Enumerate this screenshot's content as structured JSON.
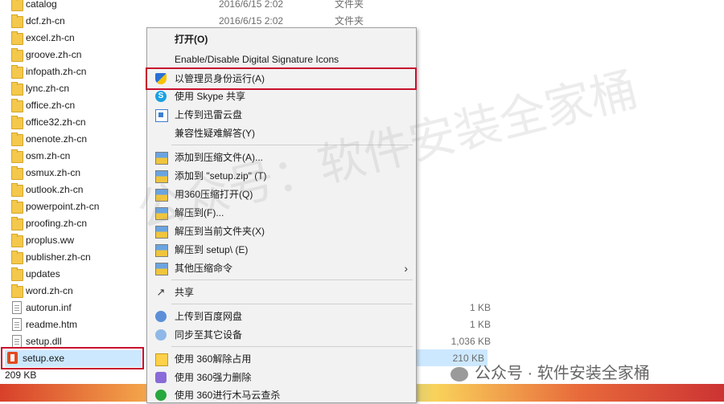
{
  "files": [
    {
      "name": "catalog",
      "date": "2016/6/15 2:02",
      "type": "文件夹",
      "size": "",
      "icon": "folder-icon"
    },
    {
      "name": "dcf.zh-cn",
      "date": "2016/6/15 2:02",
      "type": "文件夹",
      "size": "",
      "icon": "folder-icon"
    },
    {
      "name": "excel.zh-cn",
      "date": "",
      "type": "",
      "size": "",
      "icon": "folder-icon"
    },
    {
      "name": "groove.zh-cn",
      "date": "",
      "type": "",
      "size": "",
      "icon": "folder-icon"
    },
    {
      "name": "infopath.zh-cn",
      "date": "",
      "type": "",
      "size": "",
      "icon": "folder-icon"
    },
    {
      "name": "lync.zh-cn",
      "date": "",
      "type": "",
      "size": "",
      "icon": "folder-icon"
    },
    {
      "name": "office.zh-cn",
      "date": "",
      "type": "",
      "size": "",
      "icon": "folder-icon"
    },
    {
      "name": "office32.zh-cn",
      "date": "",
      "type": "",
      "size": "",
      "icon": "folder-icon"
    },
    {
      "name": "onenote.zh-cn",
      "date": "",
      "type": "",
      "size": "",
      "icon": "folder-icon"
    },
    {
      "name": "osm.zh-cn",
      "date": "",
      "type": "",
      "size": "",
      "icon": "folder-icon"
    },
    {
      "name": "osmux.zh-cn",
      "date": "",
      "type": "",
      "size": "",
      "icon": "folder-icon"
    },
    {
      "name": "outlook.zh-cn",
      "date": "",
      "type": "",
      "size": "",
      "icon": "folder-icon"
    },
    {
      "name": "powerpoint.zh-cn",
      "date": "",
      "type": "",
      "size": "",
      "icon": "folder-icon"
    },
    {
      "name": "proofing.zh-cn",
      "date": "",
      "type": "",
      "size": "",
      "icon": "folder-icon"
    },
    {
      "name": "proplus.ww",
      "date": "",
      "type": "",
      "size": "",
      "icon": "folder-icon"
    },
    {
      "name": "publisher.zh-cn",
      "date": "",
      "type": "",
      "size": "",
      "icon": "folder-icon"
    },
    {
      "name": "updates",
      "date": "",
      "type": "",
      "size": "",
      "icon": "folder-icon"
    },
    {
      "name": "word.zh-cn",
      "date": "",
      "type": "",
      "size": "",
      "icon": "folder-icon"
    },
    {
      "name": "autorun.inf",
      "date": "",
      "type": "",
      "size": "1 KB",
      "icon": "inf-file-icon"
    },
    {
      "name": "readme.htm",
      "date": "",
      "type": "",
      "size": "1 KB",
      "icon": "htm-file-icon"
    },
    {
      "name": "setup.dll",
      "date": "",
      "type": "",
      "size": "1,036 KB",
      "icon": "dll-file-icon"
    },
    {
      "name": "setup.exe",
      "date": "",
      "type": "",
      "size": "210 KB",
      "icon": "office-setup-icon"
    }
  ],
  "status": {
    "selected_size": "209 KB"
  },
  "context_menu": {
    "items": [
      {
        "label": "打开(O)",
        "icon": "",
        "bold": true
      },
      {
        "label": "Enable/Disable Digital Signature Icons",
        "icon": ""
      },
      {
        "label": "以管理员身份运行(A)",
        "icon": "uac-shield-icon"
      },
      {
        "label": "使用 Skype 共享",
        "icon": "skype-icon"
      },
      {
        "label": "上传到迅雷云盘",
        "icon": "xunlei-cloud-icon"
      },
      {
        "label": "兼容性疑难解答(Y)",
        "icon": ""
      },
      {
        "label": "添加到压缩文件(A)...",
        "icon": "archive-icon"
      },
      {
        "label": "添加到 \"setup.zip\" (T)",
        "icon": "archive-icon"
      },
      {
        "label": "用360压缩打开(Q)",
        "icon": "archive-icon"
      },
      {
        "label": "解压到(F)...",
        "icon": "archive-icon"
      },
      {
        "label": "解压到当前文件夹(X)",
        "icon": "archive-icon"
      },
      {
        "label": "解压到 setup\\ (E)",
        "icon": "archive-icon"
      },
      {
        "label": "其他压缩命令",
        "icon": "archive-icon"
      },
      {
        "label": "共享",
        "icon": "share-icon"
      },
      {
        "label": "上传到百度网盘",
        "icon": "baidu-cloud-icon"
      },
      {
        "label": "同步至其它设备",
        "icon": "sync-icon"
      },
      {
        "label": "使用 360解除占用",
        "icon": "360-unlock-icon"
      },
      {
        "label": "使用 360强力删除",
        "icon": "360-delete-icon"
      },
      {
        "label": "使用 360进行木马云查杀",
        "icon": "360-scan-icon"
      }
    ],
    "submenu_arrow": "›"
  },
  "watermark": "公众号：软件安装全家桶",
  "wechat_mark": "公众号 · 软件安装全家桶",
  "colors": {
    "highlight_border": "#c8102e",
    "selection": "#cce8ff"
  }
}
